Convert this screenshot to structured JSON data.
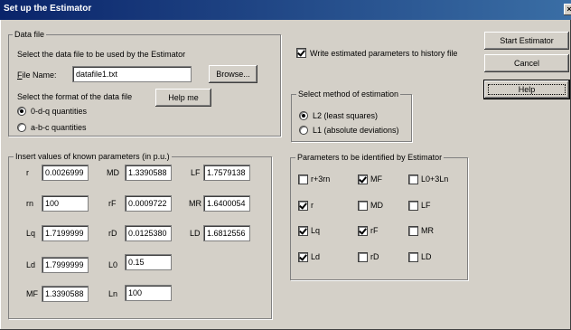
{
  "window": {
    "title": "Set up the Estimator",
    "close_label": "×"
  },
  "data_file": {
    "group_label": "Data file",
    "instruction": "Select the data file to be used by the Estimator",
    "file_name_label_u": "F",
    "file_name_label_rest": "ile Name:",
    "file_name_value": "datafile1.txt",
    "browse_label": "Browse...",
    "format_label": "Select the format of the data file",
    "help_me_label": "Help me",
    "format_options": [
      {
        "label": "0-d-q quantities",
        "selected": true
      },
      {
        "label": "a-b-c quantities",
        "selected": false
      }
    ]
  },
  "params": {
    "group_label": "Insert values of known parameters (in p.u.)",
    "fields": [
      {
        "label": "r",
        "value": "0.0026999"
      },
      {
        "label": "MD",
        "value": "1.3390588"
      },
      {
        "label": "LF",
        "value": "1.7579138"
      },
      {
        "label": "rn",
        "value": "100"
      },
      {
        "label": "rF",
        "value": "0.0009722"
      },
      {
        "label": "MR",
        "value": "1.6400054"
      },
      {
        "label": "Lq",
        "value": "1.7199999"
      },
      {
        "label": "rD",
        "value": "0.0125380"
      },
      {
        "label": "LD",
        "value": "1.6812556"
      },
      {
        "label": "Ld",
        "value": "1.7999999"
      },
      {
        "label": "L0",
        "value": "0.15"
      },
      {
        "label": "MF",
        "value": "1.3390588"
      },
      {
        "label": "Ln",
        "value": "100"
      }
    ]
  },
  "history": {
    "label": "Write estimated parameters to history file",
    "checked": true
  },
  "method": {
    "group_label": "Select method of estimation",
    "options": [
      {
        "label": "L2 (least squares)",
        "selected": true
      },
      {
        "label": "L1 (absolute deviations)",
        "selected": false
      }
    ]
  },
  "identify": {
    "group_label": "Parameters to be identified by Estimator",
    "items": [
      {
        "label": "r+3rn",
        "checked": false
      },
      {
        "label": "MF",
        "checked": true
      },
      {
        "label": "L0+3Ln",
        "checked": false
      },
      {
        "label": "r",
        "checked": true
      },
      {
        "label": "MD",
        "checked": false
      },
      {
        "label": "LF",
        "checked": false
      },
      {
        "label": "Lq",
        "checked": true
      },
      {
        "label": "rF",
        "checked": true
      },
      {
        "label": "MR",
        "checked": false
      },
      {
        "label": "Ld",
        "checked": true
      },
      {
        "label": "rD",
        "checked": false
      },
      {
        "label": "LD",
        "checked": false
      }
    ]
  },
  "buttons": {
    "start": "Start Estimator",
    "cancel": "Cancel",
    "help": "Help"
  }
}
